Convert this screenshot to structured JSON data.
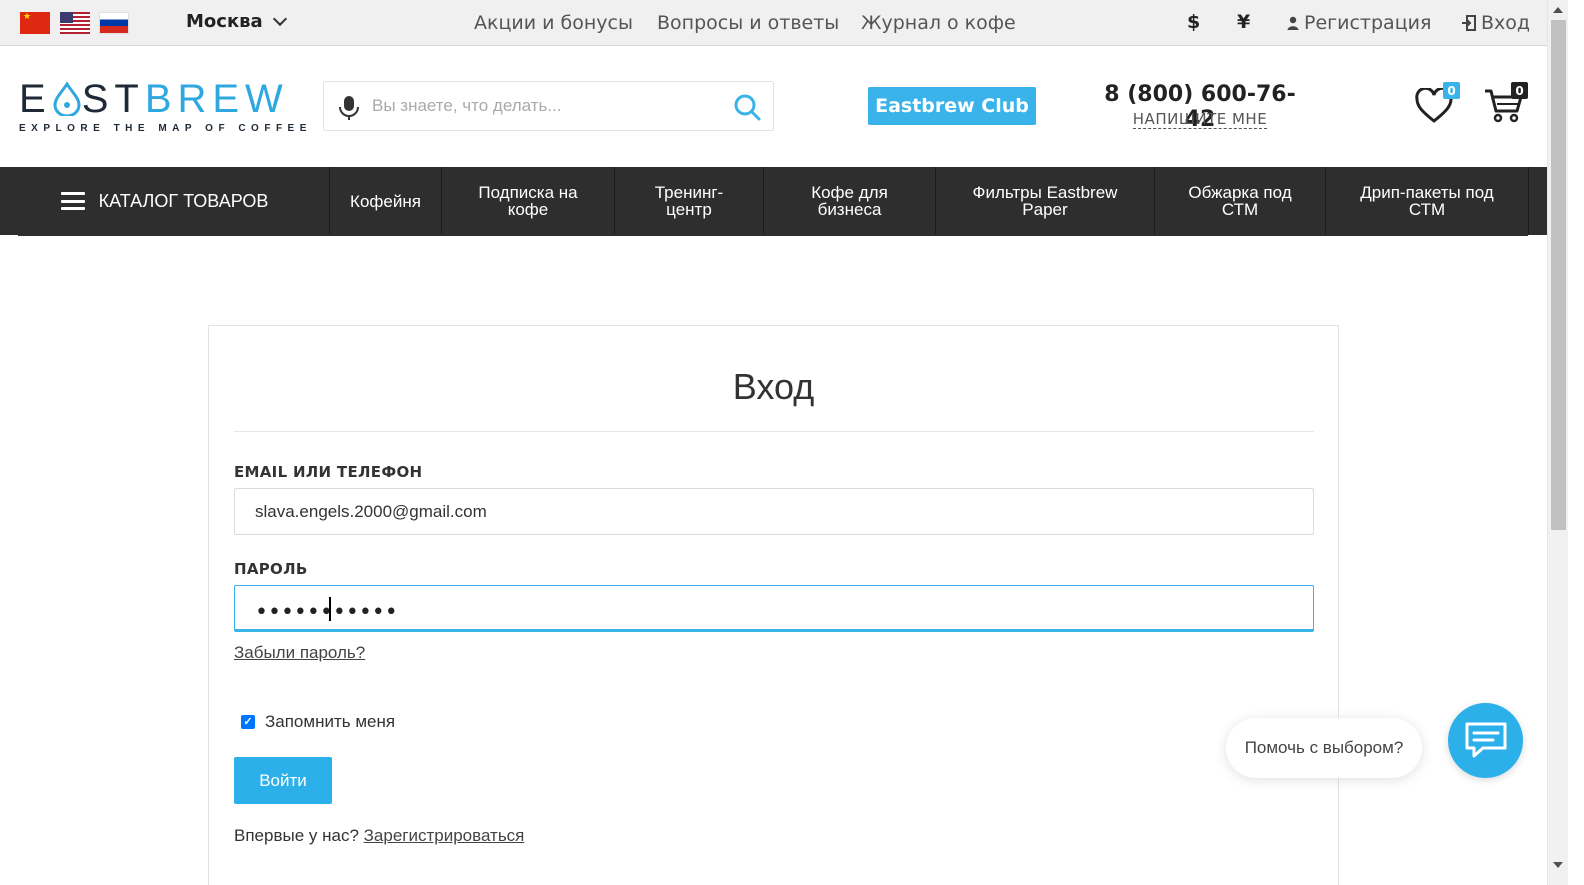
{
  "topbar": {
    "languages": [
      {
        "name": "Chinese",
        "icon": "flag-cn-icon"
      },
      {
        "name": "English",
        "icon": "flag-us-icon"
      },
      {
        "name": "Russian",
        "icon": "flag-ru-icon"
      }
    ],
    "city": "Москва",
    "links": [
      "Акции и бонусы",
      "Вопросы и ответы",
      "Журнал о кофе"
    ],
    "currencies": [
      "$",
      "¥"
    ],
    "register_label": "Регистрация",
    "login_label": "Вход"
  },
  "header": {
    "logo": {
      "word_dark_1": "E",
      "word_dark_2": "ST",
      "word_blue": "BREW",
      "tagline": "EXPLORE THE MAP OF COFFEE"
    },
    "search": {
      "placeholder": "Вы знаете, что делать..."
    },
    "club_label": "Eastbrew Club",
    "phone": "8 (800) 600-76-42",
    "write_me": "НАПИШИТЕ МНЕ",
    "wishlist_count": "0",
    "cart_count": "0"
  },
  "nav": {
    "catalog_label": "КАТАЛОГ ТОВАРОВ",
    "items": [
      {
        "line1": "Кофейня",
        "line2": ""
      },
      {
        "line1": "Подписка на",
        "line2": "кофе"
      },
      {
        "line1": "Тренинг-",
        "line2": "центр"
      },
      {
        "line1": "Кофе для",
        "line2": "бизнеса"
      },
      {
        "line1": "Фильтры Eastbrew",
        "line2": "Paper"
      },
      {
        "line1": "Обжарка под",
        "line2": "СТМ"
      },
      {
        "line1": "Дрип-пакеты под",
        "line2": "СТМ"
      }
    ]
  },
  "login": {
    "title": "Вход",
    "email_label": "EMAIL ИЛИ ТЕЛЕФОН",
    "email_value": "slava.engels.2000@gmail.com",
    "password_label": "ПАРОЛЬ",
    "password_mask": "•••••••••••",
    "forgot_label": "Забыли пароль?",
    "remember_label": "Запомнить меня",
    "remember_checked": true,
    "submit_label": "Войти",
    "new_here_text": "Впервые у нас?",
    "register_link": "Зарегистрироваться"
  },
  "chat": {
    "bubble_text": "Помочь с выбором?",
    "icon": "chat-icon"
  },
  "colors": {
    "accent": "#3ab3ea",
    "nav_bg": "#2e2e2e",
    "topbar_bg": "#f0f0f0"
  }
}
